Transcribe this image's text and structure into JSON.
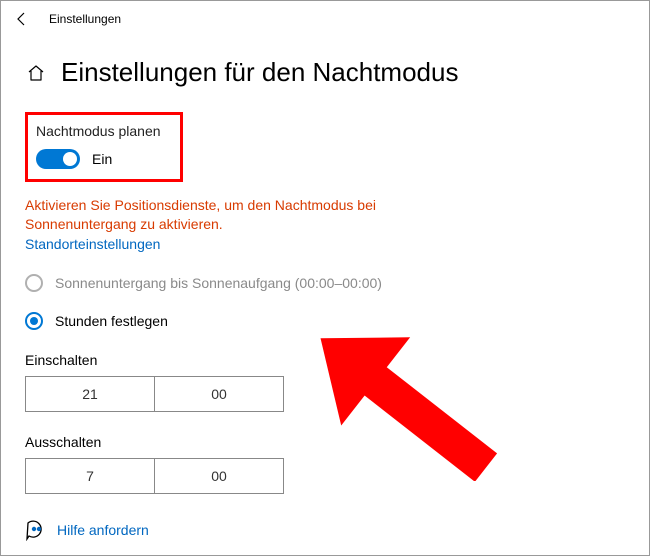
{
  "titlebar": {
    "title": "Einstellungen"
  },
  "page": {
    "heading": "Einstellungen für den Nachtmodus"
  },
  "schedule": {
    "section_label": "Nachtmodus planen",
    "toggle_state": "Ein"
  },
  "location": {
    "warning": "Aktivieren Sie Positionsdienste, um den Nachtmodus bei Sonnenuntergang zu aktivieren.",
    "settings_link": "Standorteinstellungen"
  },
  "options": {
    "sunset": "Sonnenuntergang bis Sonnenaufgang (00:00–00:00)",
    "set_hours": "Stunden festlegen"
  },
  "turn_on": {
    "label": "Einschalten",
    "hour": "21",
    "minute": "00"
  },
  "turn_off": {
    "label": "Ausschalten",
    "hour": "7",
    "minute": "00"
  },
  "help": {
    "link": "Hilfe anfordern"
  }
}
